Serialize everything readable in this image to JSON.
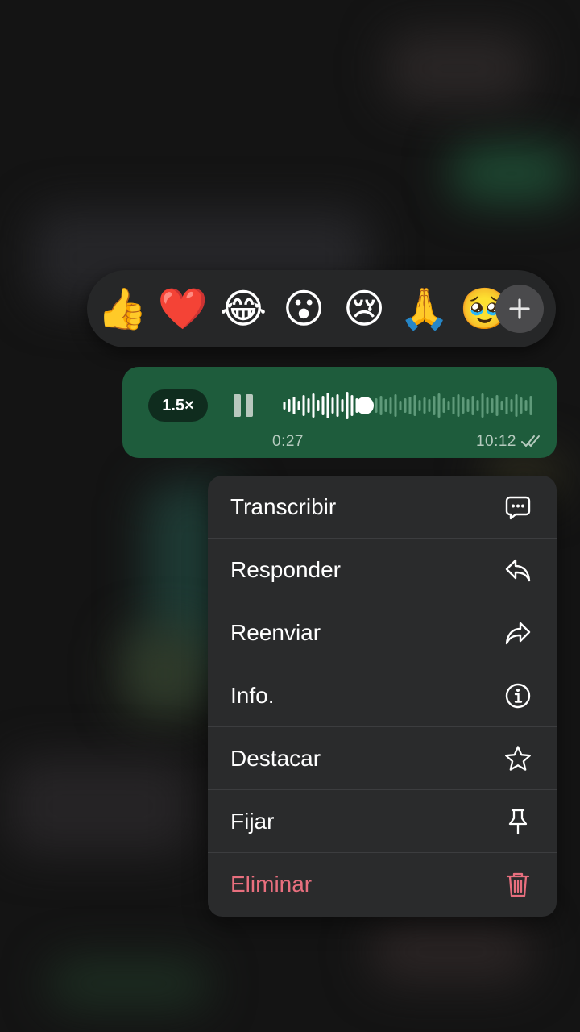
{
  "reactions": {
    "items": [
      {
        "emoji": "👍",
        "name": "thumbs-up"
      },
      {
        "emoji": "❤️",
        "name": "red-heart"
      },
      {
        "emoji": "😂",
        "name": "tears-of-joy"
      },
      {
        "emoji": "😮",
        "name": "surprised-face"
      },
      {
        "emoji": "😢",
        "name": "crying-face"
      },
      {
        "emoji": "🙏",
        "name": "folded-hands"
      },
      {
        "emoji": "🥹",
        "name": "holding-back-tears"
      }
    ],
    "more_icon": "plus-icon"
  },
  "voice_message": {
    "speed": "1.5×",
    "elapsed": "0:27",
    "sent_time": "10:12",
    "progress": 0.33,
    "status_icon": "double-check-icon",
    "bubble_color": "#1e5c3c"
  },
  "menu": {
    "items": [
      {
        "label": "Transcribir",
        "icon": "speech-bubble-dots-icon"
      },
      {
        "label": "Responder",
        "icon": "reply-icon"
      },
      {
        "label": "Reenviar",
        "icon": "forward-icon"
      },
      {
        "label": "Info.",
        "icon": "info-icon"
      },
      {
        "label": "Destacar",
        "icon": "star-icon"
      },
      {
        "label": "Fijar",
        "icon": "pin-icon"
      },
      {
        "label": "Eliminar",
        "icon": "trash-icon",
        "destructive": true
      }
    ],
    "destructive_color": "#e86f7e"
  }
}
